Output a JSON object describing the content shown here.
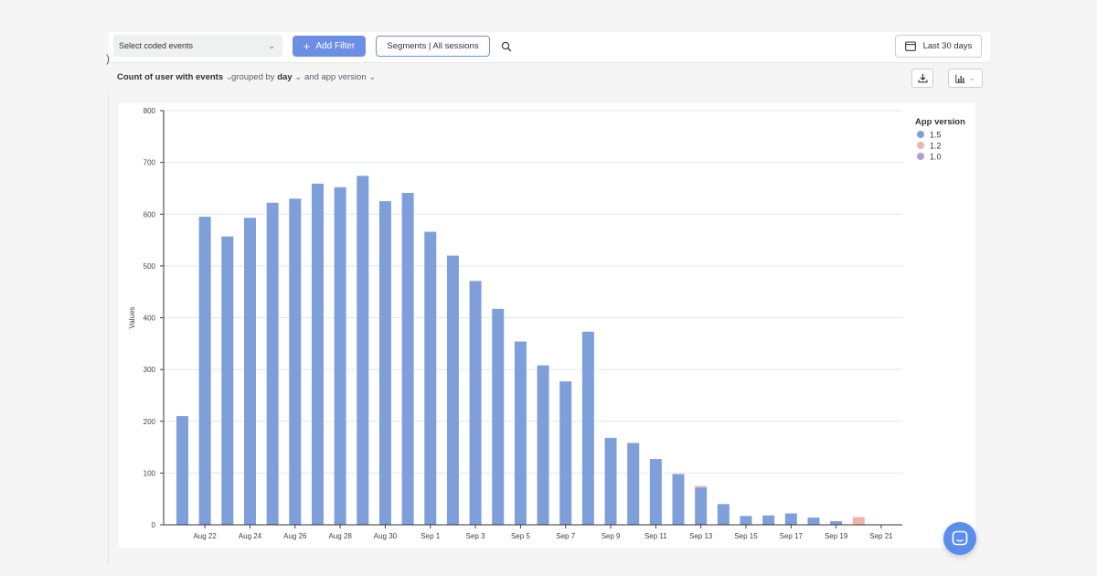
{
  "toolbar": {
    "event_select_label": "Select coded events",
    "add_filter_label": "Add Filter",
    "segments_label": "Segments | All sessions",
    "date_range_label": "Last 30 days"
  },
  "query": {
    "metric_label": "Count of user with events",
    "grouped_prefix": "grouped by",
    "grouped_value": "day",
    "and_label": "and app version"
  },
  "colors": {
    "accent": "#6c8fe6",
    "series_1_5": "#7f9fdb",
    "series_1_2": "#f0b5a6",
    "series_1_0": "#b79bd2"
  },
  "chart_data": {
    "type": "bar",
    "ylabel": "Values",
    "ylim": [
      0,
      800
    ],
    "yticks": [
      0,
      100,
      200,
      300,
      400,
      500,
      600,
      700,
      800
    ],
    "legend_title": "App version",
    "legend_position": "top-right",
    "grid": true,
    "categories": [
      "Aug 21",
      "Aug 22",
      "Aug 23",
      "Aug 24",
      "Aug 25",
      "Aug 26",
      "Aug 27",
      "Aug 28",
      "Aug 29",
      "Aug 30",
      "Aug 31",
      "Sep 1",
      "Sep 2",
      "Sep 3",
      "Sep 4",
      "Sep 5",
      "Sep 6",
      "Sep 7",
      "Sep 8",
      "Sep 9",
      "Sep 10",
      "Sep 11",
      "Sep 12",
      "Sep 13",
      "Sep 14",
      "Sep 15",
      "Sep 16",
      "Sep 17",
      "Sep 18",
      "Sep 19",
      "Sep 20",
      "Sep 21"
    ],
    "tick_labels": [
      "Aug 22",
      "Aug 24",
      "Aug 26",
      "Aug 28",
      "Aug 30",
      "Sep 1",
      "Sep 3",
      "Sep 5",
      "Sep 7",
      "Sep 9",
      "Sep 11",
      "Sep 13",
      "Sep 15",
      "Sep 17",
      "Sep 19",
      "Sep 21"
    ],
    "series": [
      {
        "name": "1.5",
        "values": [
          210,
          595,
          557,
          593,
          622,
          630,
          659,
          652,
          674,
          625,
          641,
          566,
          520,
          471,
          417,
          354,
          308,
          277,
          373,
          168,
          158,
          127,
          98,
          72,
          40,
          17,
          18,
          22,
          14,
          7,
          0,
          0
        ]
      },
      {
        "name": "1.2",
        "values": [
          0,
          0,
          0,
          0,
          0,
          0,
          0,
          0,
          0,
          0,
          0,
          0,
          0,
          0,
          0,
          0,
          0,
          0,
          0,
          0,
          0,
          0,
          0,
          3,
          0,
          0,
          0,
          0,
          0,
          0,
          15,
          0
        ]
      },
      {
        "name": "1.0",
        "values": [
          0,
          0,
          0,
          0,
          0,
          0,
          0,
          0,
          0,
          0,
          0,
          0,
          0,
          0,
          0,
          0,
          0,
          0,
          0,
          0,
          0,
          0,
          0,
          0,
          0,
          0,
          0,
          0,
          0,
          0,
          0,
          0
        ]
      }
    ]
  }
}
